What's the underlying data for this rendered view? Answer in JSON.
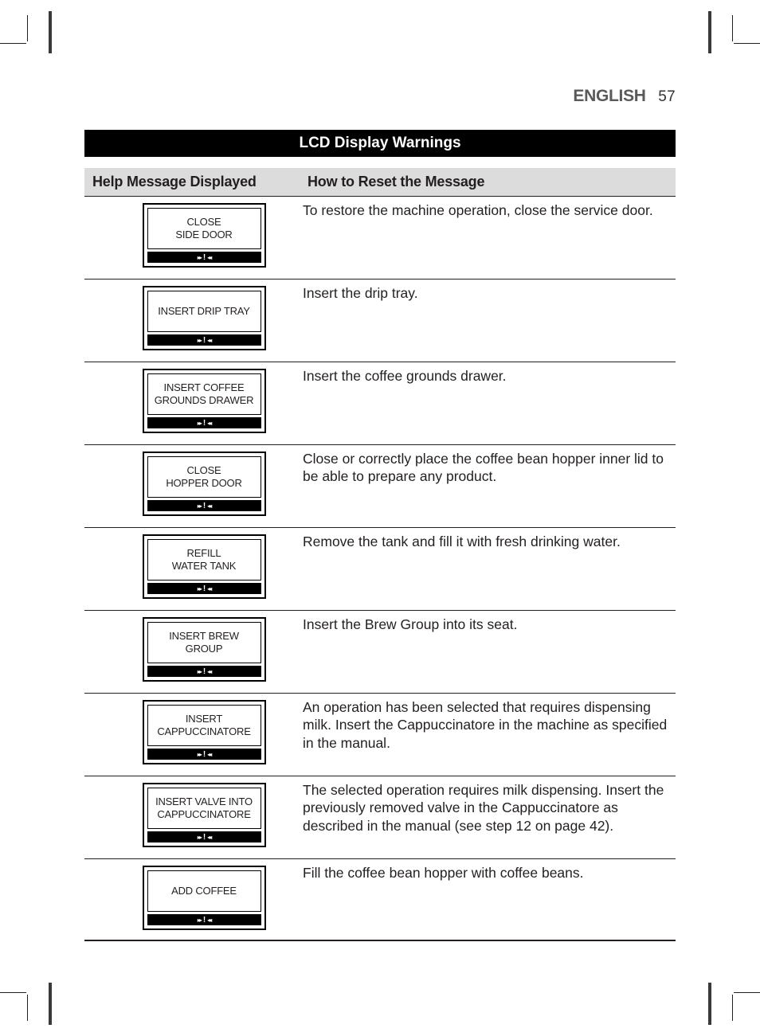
{
  "running_head": {
    "language": "ENGLISH",
    "page_number": "57"
  },
  "title": "LCD Display Warnings",
  "columns": {
    "left": "Help Message Displayed",
    "right": "How to Reset the Message"
  },
  "rows": [
    {
      "lcd": "CLOSE\nSIDE DOOR",
      "reset": "To restore the machine operation, close the service door."
    },
    {
      "lcd": "INSERT DRIP TRAY",
      "reset": "Insert the drip tray."
    },
    {
      "lcd": "INSERT COFFEE\nGROUNDS DRAWER",
      "reset": "Insert the coffee grounds drawer."
    },
    {
      "lcd": "CLOSE\nHOPPER DOOR",
      "reset": "Close or correctly place the coffee bean hopper inner lid to be able to prepare any product."
    },
    {
      "lcd": "REFILL\nWATER TANK",
      "reset": "Remove the tank and fill it with fresh drinking water."
    },
    {
      "lcd": "INSERT BREW GROUP",
      "reset": "Insert the Brew Group into its seat."
    },
    {
      "lcd": "INSERT\nCAPPUCCINATORE",
      "reset": "An operation has been selected that requires dispensing milk. Insert the Cappuccinatore in the machine as specified in the manual."
    },
    {
      "lcd": "INSERT VALVE INTO\nCAPPUCCINATORE",
      "reset": "The selected operation requires milk dispensing. Insert the previously removed valve in the Cappuccinatore as described in the manual (see step 12 on page 42)."
    },
    {
      "lcd": "ADD COFFEE",
      "reset": "Fill the coffee bean hopper with coffee beans."
    }
  ],
  "lcd_strip_glyph": "▸▸❚◂◂"
}
